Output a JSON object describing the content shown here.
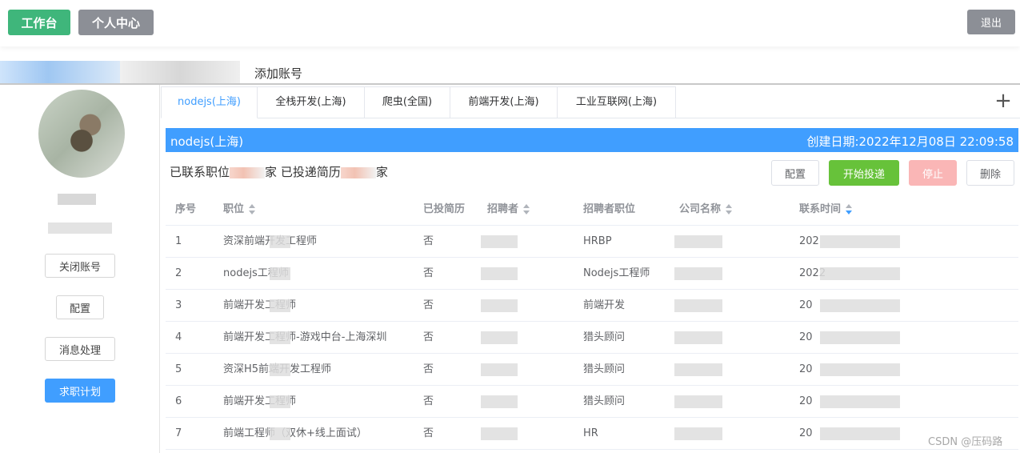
{
  "topbar": {
    "workbench_label": "工作台",
    "personal_center_label": "个人中心",
    "logout_label": "退出"
  },
  "accounts": {
    "add_account_label": "添加账号"
  },
  "sidebar": {
    "close_account_label": "关闭账号",
    "config_label": "配置",
    "messages_label": "消息处理",
    "job_plan_label": "求职计划"
  },
  "tabs": [
    {
      "label": "nodejs(上海)",
      "active": true
    },
    {
      "label": "全栈开发(上海)",
      "active": false
    },
    {
      "label": "爬虫(全国)",
      "active": false
    },
    {
      "label": "前端开发(上海)",
      "active": false
    },
    {
      "label": "工业互联网(上海)",
      "active": false
    }
  ],
  "tab_add_icon": "plus-icon",
  "panel": {
    "title": "nodejs(上海)",
    "created": "创建日期:2022年12月08日 22:09:58",
    "summary_contacted": "已联系职位",
    "summary_unit_1": "家",
    "summary_sent": "已投递简历",
    "summary_unit_2": "家",
    "config_label": "配置",
    "start_label": "开始投递",
    "stop_label": "停止",
    "delete_label": "删除"
  },
  "table": {
    "headers": {
      "index": "序号",
      "position": "职位",
      "sent": "已投简历",
      "recruiter": "招聘者",
      "recruiter_title": "招聘者职位",
      "company": "公司名称",
      "contact_time": "联系时间"
    },
    "rows": [
      {
        "index": "1",
        "position": "资深前端开发工程师",
        "sent": "否",
        "recruiter_title": "HRBP",
        "company": "",
        "time": "202"
      },
      {
        "index": "2",
        "position": "nodejs工程师",
        "sent": "否",
        "recruiter_title": "Nodejs工程师",
        "company": "",
        "time": "2022"
      },
      {
        "index": "3",
        "position": "前端开发工程师",
        "sent": "否",
        "recruiter_title": "前端开发",
        "company": "",
        "time": "20"
      },
      {
        "index": "4",
        "position": "前端开发工程师-游戏中台-上海深圳",
        "sent": "否",
        "recruiter_title": "猎头顾问",
        "company": "",
        "time": "20"
      },
      {
        "index": "5",
        "position": "资深H5前端开发工程师",
        "sent": "否",
        "recruiter_title": "猎头顾问",
        "company": "",
        "time": "20"
      },
      {
        "index": "6",
        "position": "前端开发工程师",
        "sent": "否",
        "recruiter_title": "猎头顾问",
        "company": "",
        "time": "20"
      },
      {
        "index": "7",
        "position": "前端工程师（双休+线上面试）",
        "sent": "否",
        "recruiter_title": "HR",
        "company": "",
        "time": "20"
      }
    ]
  },
  "watermark": "CSDN @压码路",
  "colors": {
    "primary": "#409eff",
    "success": "#67c23a",
    "workbench": "#3fb67b",
    "gray_button": "#8c8f96",
    "danger_light": "#fab6b6"
  }
}
